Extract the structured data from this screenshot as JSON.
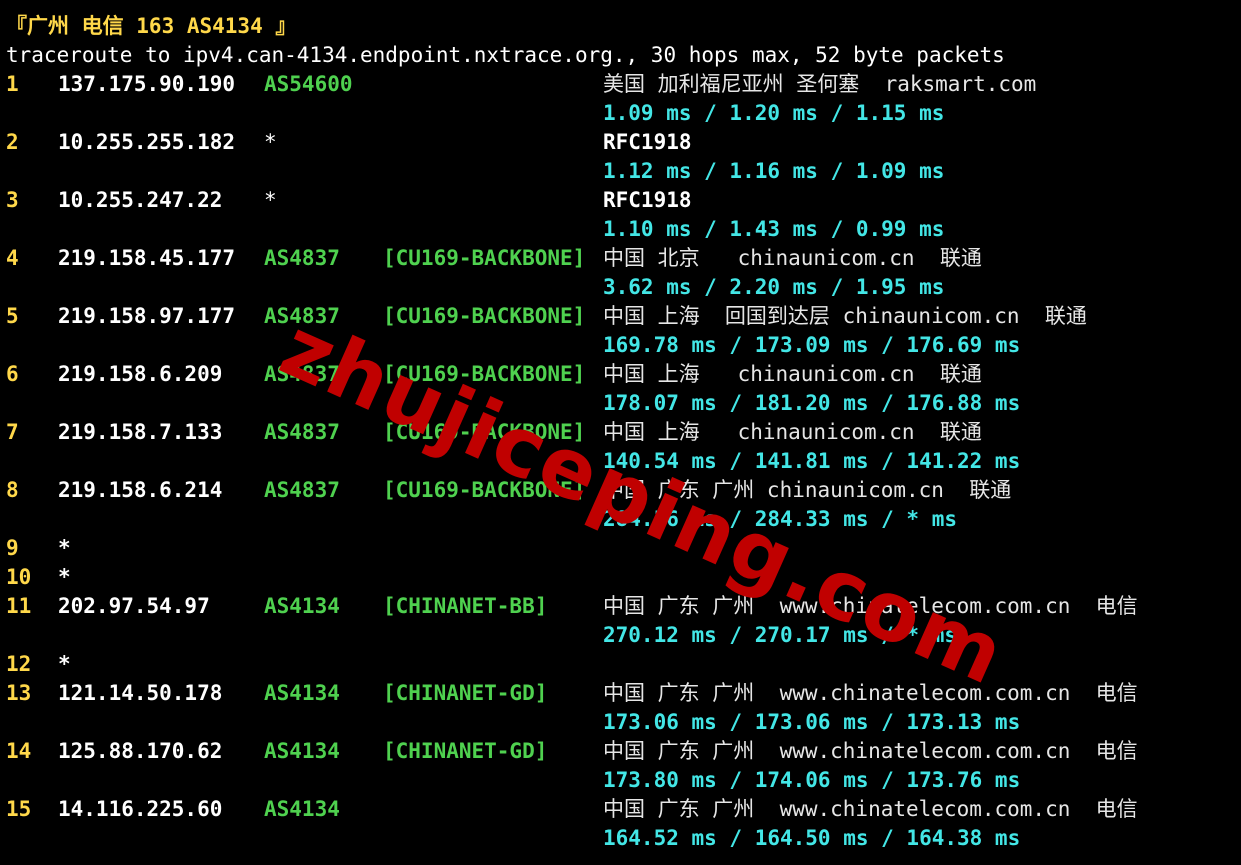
{
  "title": "『广州 电信 163 AS4134 』",
  "header": "traceroute to ipv4.can-4134.endpoint.nxtrace.org., 30 hops max, 52 byte packets",
  "watermark": "zhujiceping.com",
  "colors": {
    "background": "#000000",
    "hop": "#ffd84a",
    "asn": "#4fd14f",
    "rtt": "#43e6e6",
    "watermark": "#c00000"
  },
  "hops": [
    {
      "n": "1",
      "ip": "137.175.90.190",
      "asn": "AS54600",
      "tag": "",
      "geo": "美国 加利福尼亚州 圣何塞  raksmart.com",
      "rtt": "1.09 ms / 1.20 ms / 1.15 ms"
    },
    {
      "n": "2",
      "ip": "10.255.255.182",
      "asn": "*",
      "tag": "",
      "geo": "RFC1918",
      "rtt": "1.12 ms / 1.16 ms / 1.09 ms"
    },
    {
      "n": "3",
      "ip": "10.255.247.22",
      "asn": "*",
      "tag": "",
      "geo": "RFC1918",
      "rtt": "1.10 ms / 1.43 ms / 0.99 ms"
    },
    {
      "n": "4",
      "ip": "219.158.45.177",
      "asn": "AS4837",
      "tag": "[CU169-BACKBONE]",
      "geo": "中国 北京   chinaunicom.cn  联通",
      "rtt": "3.62 ms / 2.20 ms / 1.95 ms"
    },
    {
      "n": "5",
      "ip": "219.158.97.177",
      "asn": "AS4837",
      "tag": "[CU169-BACKBONE]",
      "geo": "中国 上海  回国到达层 chinaunicom.cn  联通",
      "rtt": "169.78 ms / 173.09 ms / 176.69 ms"
    },
    {
      "n": "6",
      "ip": "219.158.6.209",
      "asn": "AS4837",
      "tag": "[CU169-BACKBONE]",
      "geo": "中国 上海   chinaunicom.cn  联通",
      "rtt": "178.07 ms / 181.20 ms / 176.88 ms"
    },
    {
      "n": "7",
      "ip": "219.158.7.133",
      "asn": "AS4837",
      "tag": "[CU169-BACKBONE]",
      "geo": "中国 上海   chinaunicom.cn  联通",
      "rtt": "140.54 ms / 141.81 ms / 141.22 ms"
    },
    {
      "n": "8",
      "ip": "219.158.6.214",
      "asn": "AS4837",
      "tag": "[CU169-BACKBONE]",
      "geo": "中国 广东 广州 chinaunicom.cn  联通",
      "rtt": "284.56 ms / 284.33 ms / * ms"
    },
    {
      "n": "9",
      "ip": "*",
      "asn": "",
      "tag": "",
      "geo": "",
      "rtt": ""
    },
    {
      "n": "10",
      "ip": "*",
      "asn": "",
      "tag": "",
      "geo": "",
      "rtt": ""
    },
    {
      "n": "11",
      "ip": "202.97.54.97",
      "asn": "AS4134",
      "tag": "[CHINANET-BB]",
      "geo": "中国 广东 广州  www.chinatelecom.com.cn  电信",
      "rtt": "270.12 ms / 270.17 ms / * ms"
    },
    {
      "n": "12",
      "ip": "*",
      "asn": "",
      "tag": "",
      "geo": "",
      "rtt": ""
    },
    {
      "n": "13",
      "ip": "121.14.50.178",
      "asn": "AS4134",
      "tag": "[CHINANET-GD]",
      "geo": "中国 广东 广州  www.chinatelecom.com.cn  电信",
      "rtt": "173.06 ms / 173.06 ms / 173.13 ms"
    },
    {
      "n": "14",
      "ip": "125.88.170.62",
      "asn": "AS4134",
      "tag": "[CHINANET-GD]",
      "geo": "中国 广东 广州  www.chinatelecom.com.cn  电信",
      "rtt": "173.80 ms / 174.06 ms / 173.76 ms"
    },
    {
      "n": "15",
      "ip": "14.116.225.60",
      "asn": "AS4134",
      "tag": "",
      "geo": "中国 广东 广州  www.chinatelecom.com.cn  电信",
      "rtt": "164.52 ms / 164.50 ms / 164.38 ms"
    }
  ]
}
